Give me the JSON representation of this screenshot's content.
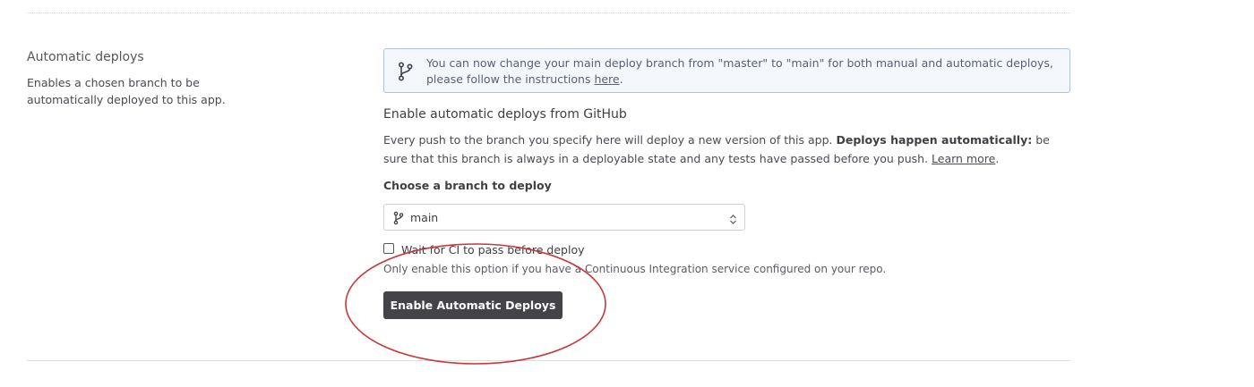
{
  "section": {
    "title": "Automatic deploys",
    "description": "Enables a chosen branch to be automatically deployed to this app."
  },
  "notice": {
    "icon": "git-branch-icon",
    "text": "You can now change your main deploy branch from \"master\" to \"main\" for both manual and automatic deploys, please follow the instructions ",
    "link_label": "here",
    "text_end": "."
  },
  "github": {
    "heading": "Enable automatic deploys from GitHub",
    "help_prefix": "Every push to the branch you specify here will deploy a new version of this app. ",
    "help_bold": "Deploys happen automatically:",
    "help_suffix": " be sure that this branch is always in a deployable state and any tests have passed before you push. ",
    "learn_more_label": "Learn more",
    "help_end": "."
  },
  "branch": {
    "label": "Choose a branch to deploy",
    "selected": "main",
    "icon": "git-branch-icon"
  },
  "ci": {
    "checked": false,
    "label": "Wait for CI to pass before deploy",
    "help": "Only enable this option if you have a Continuous Integration service configured on your repo."
  },
  "actions": {
    "enable_label": "Enable Automatic Deploys"
  },
  "colors": {
    "annotation": "#c8383a",
    "button_bg": "#434348",
    "notice_border": "#a8c3e6",
    "notice_bg": "#f4f8fd"
  }
}
